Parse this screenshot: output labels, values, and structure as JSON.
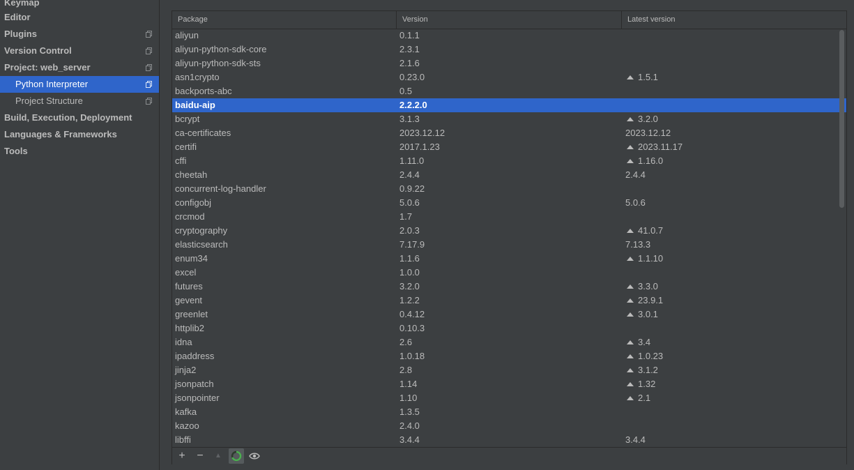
{
  "sidebar": {
    "items": [
      {
        "label": "Keymap"
      },
      {
        "label": "Editor"
      },
      {
        "label": "Plugins"
      },
      {
        "label": "Version Control"
      },
      {
        "label": "Project: web_server"
      },
      {
        "label": "Python Interpreter"
      },
      {
        "label": "Project Structure"
      },
      {
        "label": "Build, Execution, Deployment"
      },
      {
        "label": "Languages & Frameworks"
      },
      {
        "label": "Tools"
      }
    ]
  },
  "table": {
    "headers": [
      "Package",
      "Version",
      "Latest version"
    ],
    "rows": [
      {
        "pkg": "aliyun",
        "ver": "0.1.1",
        "latest": ""
      },
      {
        "pkg": "aliyun-python-sdk-core",
        "ver": "2.3.1",
        "latest": ""
      },
      {
        "pkg": "aliyun-python-sdk-sts",
        "ver": "2.1.6",
        "latest": ""
      },
      {
        "pkg": "asn1crypto",
        "ver": "0.23.0",
        "latest": "1.5.1"
      },
      {
        "pkg": "backports-abc",
        "ver": "0.5",
        "latest": ""
      },
      {
        "pkg": "baidu-aip",
        "ver": "2.2.2.0",
        "latest": ""
      },
      {
        "pkg": "bcrypt",
        "ver": "3.1.3",
        "latest": "3.2.0"
      },
      {
        "pkg": "ca-certificates",
        "ver": "2023.12.12",
        "latest": "2023.12.12"
      },
      {
        "pkg": "certifi",
        "ver": "2017.1.23",
        "latest": "2023.11.17"
      },
      {
        "pkg": "cffi",
        "ver": "1.11.0",
        "latest": "1.16.0"
      },
      {
        "pkg": "cheetah",
        "ver": "2.4.4",
        "latest": "2.4.4"
      },
      {
        "pkg": "concurrent-log-handler",
        "ver": "0.9.22",
        "latest": ""
      },
      {
        "pkg": "configobj",
        "ver": "5.0.6",
        "latest": "5.0.6"
      },
      {
        "pkg": "crcmod",
        "ver": "1.7",
        "latest": ""
      },
      {
        "pkg": "cryptography",
        "ver": "2.0.3",
        "latest": "41.0.7"
      },
      {
        "pkg": "elasticsearch",
        "ver": "7.17.9",
        "latest": "7.13.3"
      },
      {
        "pkg": "enum34",
        "ver": "1.1.6",
        "latest": "1.1.10"
      },
      {
        "pkg": "excel",
        "ver": "1.0.0",
        "latest": ""
      },
      {
        "pkg": "futures",
        "ver": "3.2.0",
        "latest": "3.3.0"
      },
      {
        "pkg": "gevent",
        "ver": "1.2.2",
        "latest": "23.9.1"
      },
      {
        "pkg": "greenlet",
        "ver": "0.4.12",
        "latest": "3.0.1"
      },
      {
        "pkg": "httplib2",
        "ver": "0.10.3",
        "latest": ""
      },
      {
        "pkg": "idna",
        "ver": "2.6",
        "latest": "3.4"
      },
      {
        "pkg": "ipaddress",
        "ver": "1.0.18",
        "latest": "1.0.23"
      },
      {
        "pkg": "jinja2",
        "ver": "2.8",
        "latest": "3.1.2"
      },
      {
        "pkg": "jsonpatch",
        "ver": "1.14",
        "latest": "1.32"
      },
      {
        "pkg": "jsonpointer",
        "ver": "1.10",
        "latest": "2.1"
      },
      {
        "pkg": "kafka",
        "ver": "1.3.5",
        "latest": ""
      },
      {
        "pkg": "kazoo",
        "ver": "2.4.0",
        "latest": ""
      },
      {
        "pkg": "libffi",
        "ver": "3.4.4",
        "latest": "3.4.4"
      }
    ],
    "upgrade_rows": [
      "asn1crypto",
      "bcrypt",
      "certifi",
      "cffi",
      "cryptography",
      "enum34",
      "futures",
      "gevent",
      "greenlet",
      "idna",
      "ipaddress",
      "jinja2",
      "jsonpatch",
      "jsonpointer"
    ],
    "selected_row": "baidu-aip"
  },
  "toolbar": {
    "add": "+",
    "remove": "−",
    "upgrade": "▲"
  },
  "colors": {
    "selection": "#2f65ca",
    "background": "#3c3f41",
    "text": "#bbbbbb",
    "spinner": "#4caf50"
  }
}
